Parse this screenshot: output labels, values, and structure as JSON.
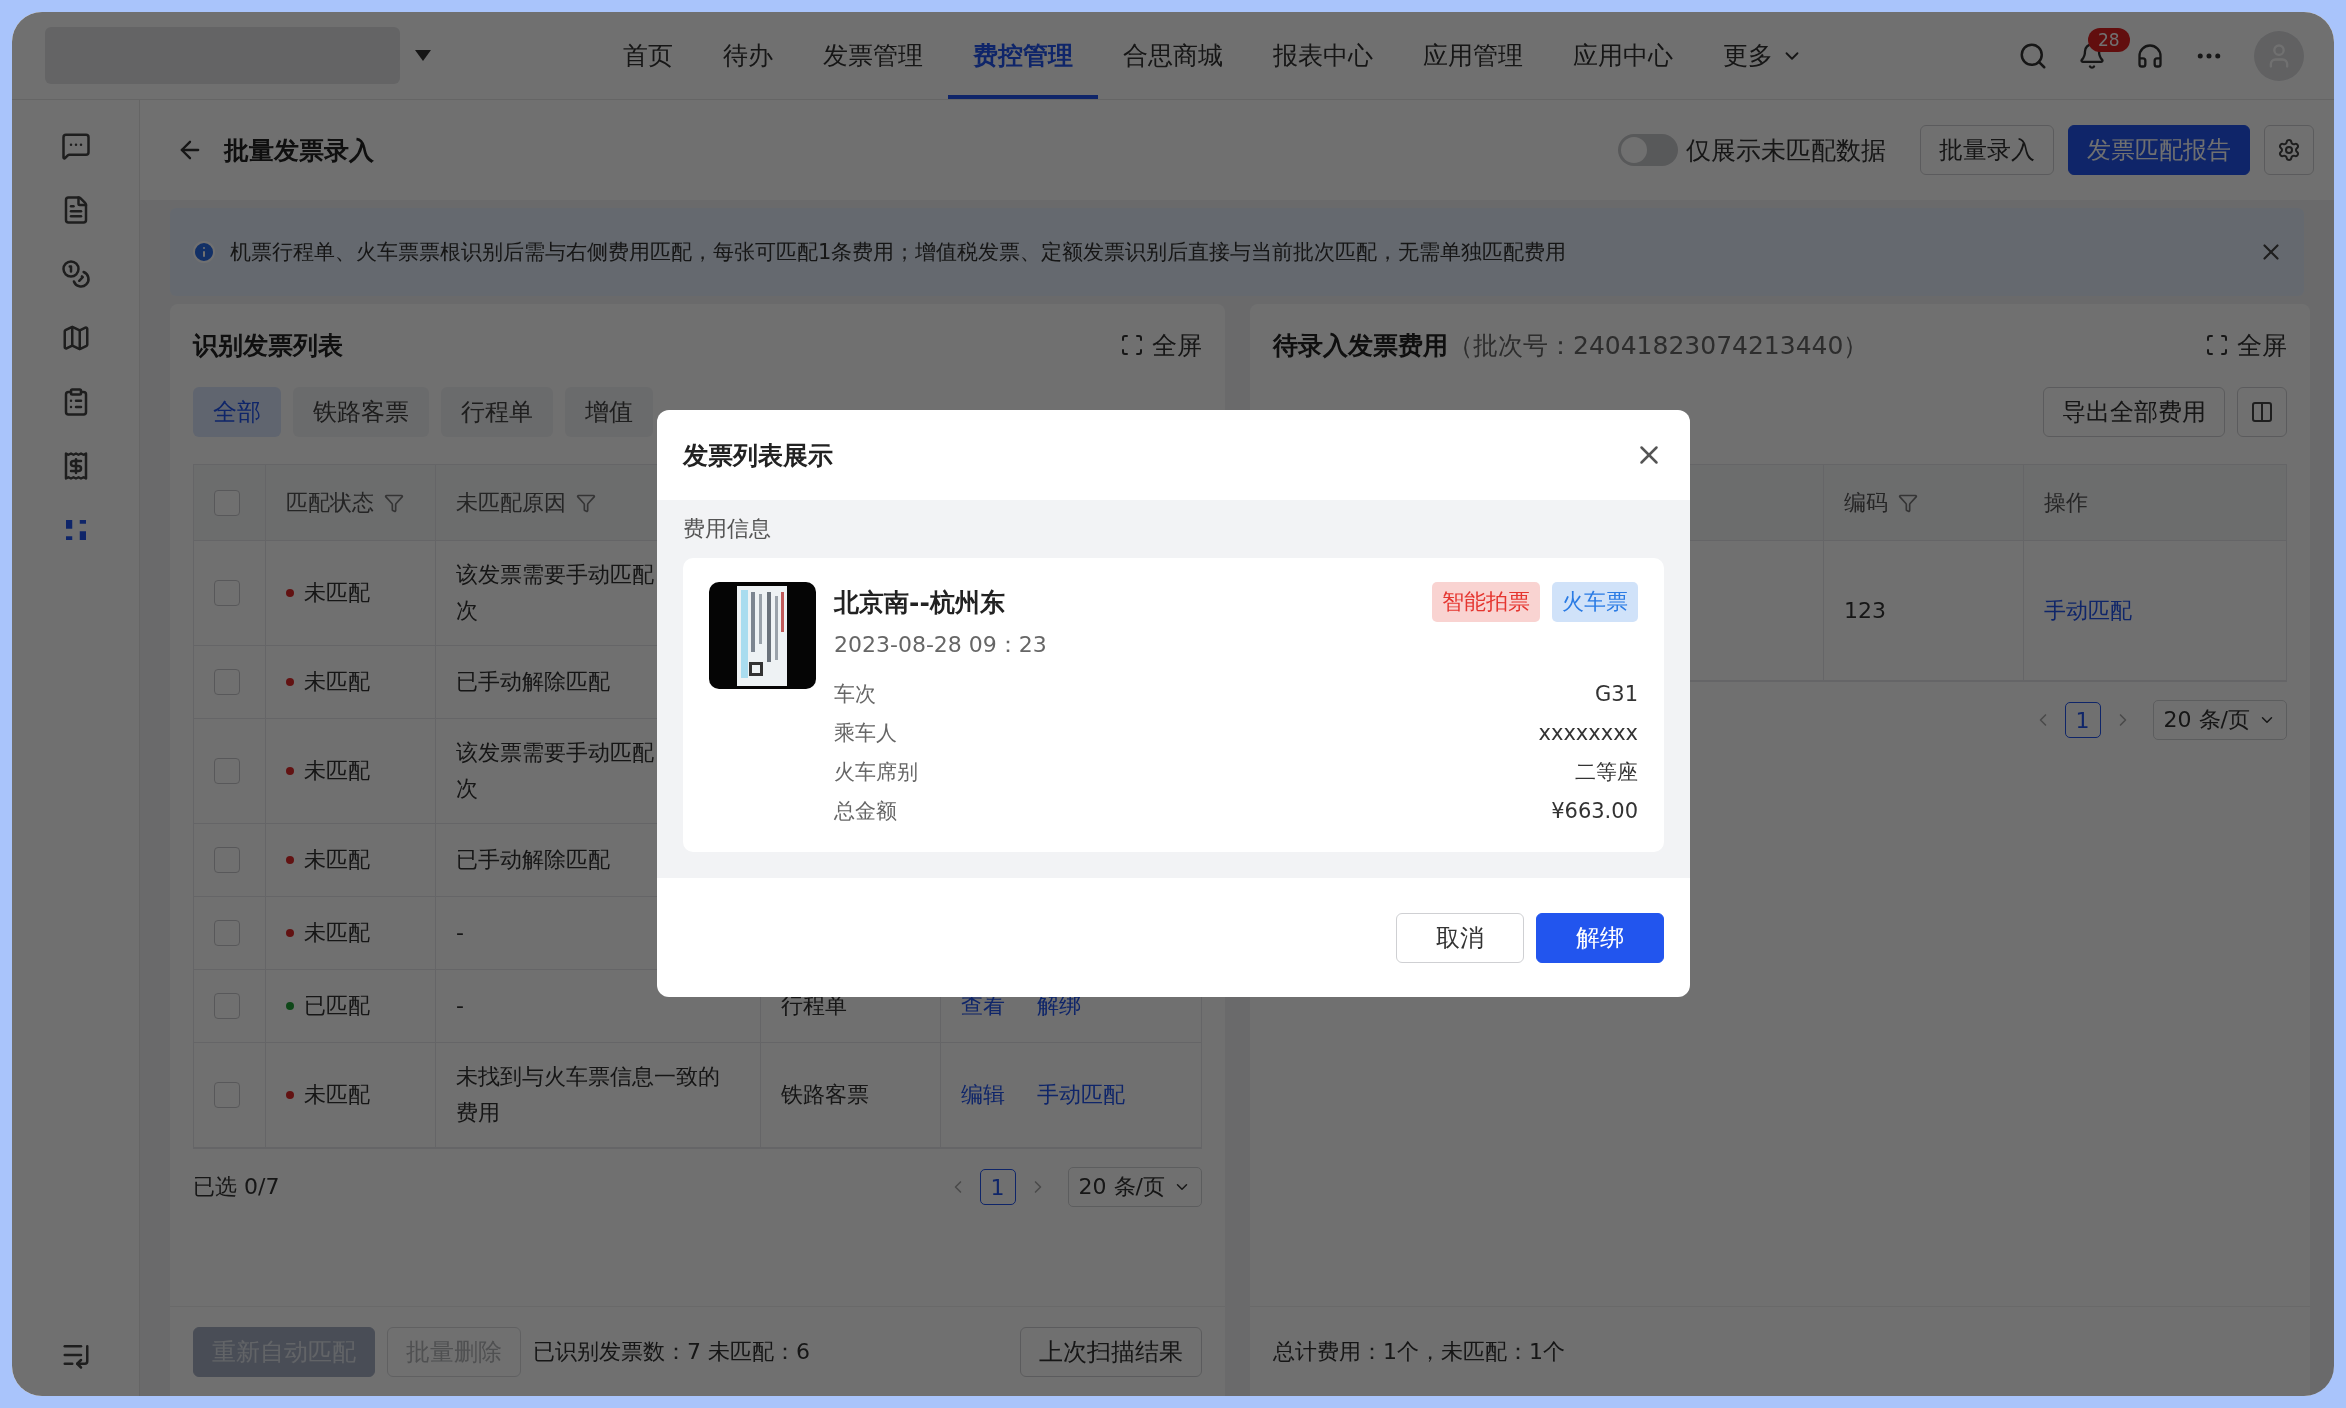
{
  "top_nav": {
    "items": [
      {
        "label": "首页",
        "selected": false
      },
      {
        "label": "待办",
        "selected": false
      },
      {
        "label": "发票管理",
        "selected": false
      },
      {
        "label": "费控管理",
        "selected": true
      },
      {
        "label": "合思商城",
        "selected": false
      },
      {
        "label": "报表中心",
        "selected": false
      },
      {
        "label": "应用管理",
        "selected": false
      },
      {
        "label": "应用中心",
        "selected": false
      },
      {
        "label": "更多",
        "selected": false,
        "kind": "dropdown"
      }
    ],
    "notification_badge": "28"
  },
  "sidebar": {
    "items": [
      {
        "kind": "message",
        "selected": false
      },
      {
        "kind": "document",
        "selected": false
      },
      {
        "kind": "money",
        "selected": false
      },
      {
        "kind": "map",
        "selected": false
      },
      {
        "kind": "list",
        "selected": false
      },
      {
        "kind": "receipt",
        "selected": false
      },
      {
        "kind": "dashboard",
        "selected": true
      }
    ]
  },
  "page_header": {
    "title": "批量发票录入",
    "toggle": {
      "label": "仅展示未匹配数据",
      "on": false
    },
    "buttons": [
      {
        "label": "批量录入",
        "kind": "default"
      },
      {
        "label": "发票匹配报告",
        "kind": "primary"
      }
    ]
  },
  "notice": {
    "text": "机票行程单、火车票票根识别后需与右侧费用匹配，每张可匹配1条费用；增值税发票、定额发票识别后直接与当前批次匹配，无需单独匹配费用"
  },
  "left_panel": {
    "title": "识别发票列表",
    "fullscreen": "全屏",
    "tabs": [
      {
        "label": "全部",
        "selected": true
      },
      {
        "label": "铁路客票",
        "selected": false
      },
      {
        "label": "行程单",
        "selected": false
      },
      {
        "label": "增值",
        "selected": false
      }
    ],
    "select_all_checked": false,
    "columns": [
      "匹配状态",
      "未匹配原因"
    ],
    "rows": [
      {
        "checked": false,
        "matched": false,
        "status": "未匹配",
        "reason_lines": [
          "该发票需要手动匹配",
          "次"
        ]
      },
      {
        "checked": false,
        "matched": false,
        "status": "未匹配",
        "reason_lines": [
          "已手动解除匹配"
        ]
      },
      {
        "checked": false,
        "matched": false,
        "status": "未匹配",
        "reason_lines": [
          "该发票需要手动匹配",
          "次"
        ]
      },
      {
        "checked": false,
        "matched": false,
        "status": "未匹配",
        "reason_lines": [
          "已手动解除匹配"
        ]
      },
      {
        "checked": false,
        "matched": false,
        "status": "未匹配",
        "reason_lines": [
          "-"
        ]
      },
      {
        "checked": false,
        "matched": true,
        "status": "已匹配",
        "reason_lines": [
          "-"
        ],
        "type": "行程单",
        "actions": [
          "查看",
          "解绑"
        ]
      },
      {
        "checked": false,
        "matched": false,
        "status": "未匹配",
        "reason_lines": [
          "未找到与火车票信息一致的",
          "费用"
        ],
        "type": "铁路客票",
        "actions": [
          "编辑",
          "手动匹配"
        ]
      }
    ],
    "selection": "已选 0/7",
    "pagination": {
      "page": "1",
      "page_size": "20 条/页"
    },
    "footer_buttons": [
      {
        "label": "重新自动匹配",
        "kind": "primary",
        "disabled": true
      },
      {
        "label": "批量删除",
        "kind": "default",
        "disabled": true
      }
    ],
    "summary": "已识别发票数：7 未匹配：6",
    "last_scan_button": "上次扫描结果"
  },
  "right_panel": {
    "title": "待录入发票费用",
    "batch": "（批次号：24041823074213440）",
    "fullscreen": "全屏",
    "export_button": "导出全部费用",
    "columns": [
      "编码",
      "操作"
    ],
    "rows": [
      {
        "code": "123",
        "actions": [
          "手动匹配"
        ]
      }
    ],
    "pagination": {
      "page": "1",
      "page_size": "20 条/页"
    },
    "summary": "总计费用：1个，未匹配：1个"
  },
  "dialog": {
    "title": "发票列表展示",
    "section": "费用信息",
    "ticket": {
      "kind": "picture",
      "route": "北京南--杭州东",
      "time": "2023-08-28 09：23",
      "tags": [
        {
          "label": "智能拍票",
          "color": "#e5352f"
        },
        {
          "label": "火车票",
          "color": "#2a7be4"
        }
      ],
      "fields": [
        {
          "label": "车次",
          "value": "G31"
        },
        {
          "label": "乘车人",
          "value": "xxxxxxxx"
        },
        {
          "label": "火车席别",
          "value": "二等座"
        },
        {
          "label": "总金额",
          "value": "¥663.00"
        }
      ]
    },
    "buttons": [
      {
        "label": "取消",
        "kind": "default"
      },
      {
        "label": "解绑",
        "kind": "primary"
      }
    ]
  }
}
